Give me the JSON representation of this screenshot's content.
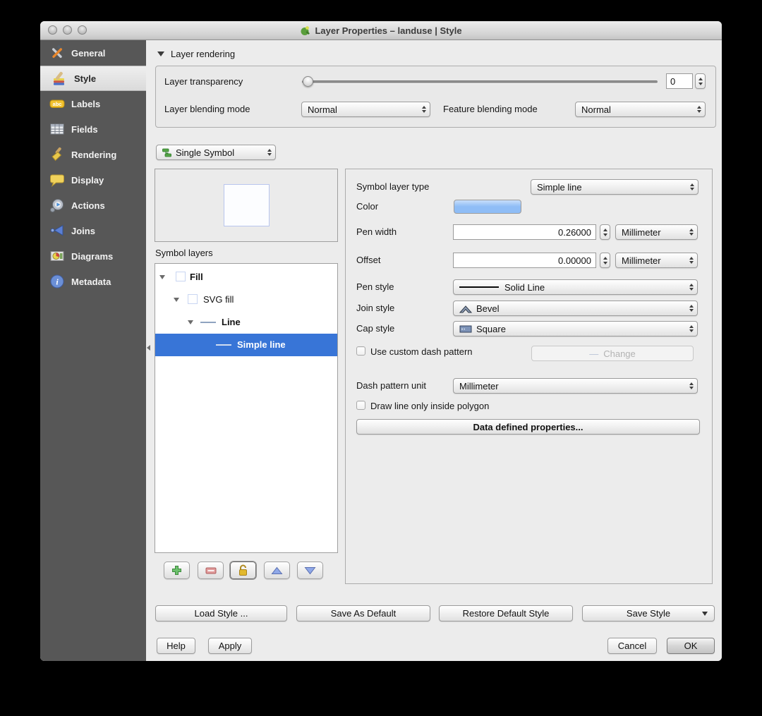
{
  "window": {
    "title": "Layer Properties – landuse | Style"
  },
  "sidebar": {
    "items": [
      {
        "label": "General"
      },
      {
        "label": "Style"
      },
      {
        "label": "Labels"
      },
      {
        "label": "Fields"
      },
      {
        "label": "Rendering"
      },
      {
        "label": "Display"
      },
      {
        "label": "Actions"
      },
      {
        "label": "Joins"
      },
      {
        "label": "Diagrams"
      },
      {
        "label": "Metadata"
      }
    ],
    "selected": "Style"
  },
  "layer_rendering": {
    "header": "Layer rendering",
    "transparency_label": "Layer transparency",
    "transparency_value": "0",
    "layer_blending_label": "Layer blending mode",
    "layer_blending_value": "Normal",
    "feature_blending_label": "Feature blending mode",
    "feature_blending_value": "Normal"
  },
  "renderer": {
    "selected": "Single Symbol"
  },
  "symbol": {
    "layers_label": "Symbol layers",
    "tree": [
      {
        "label": "Fill"
      },
      {
        "label": "SVG fill"
      },
      {
        "label": "Line"
      },
      {
        "label": "Simple line"
      }
    ]
  },
  "properties": {
    "symbol_layer_type_label": "Symbol layer type",
    "symbol_layer_type_value": "Simple line",
    "color_label": "Color",
    "pen_width_label": "Pen width",
    "pen_width_value": "0.26000",
    "pen_width_unit": "Millimeter",
    "offset_label": "Offset",
    "offset_value": "0.00000",
    "offset_unit": "Millimeter",
    "pen_style_label": "Pen style",
    "pen_style_value": "Solid Line",
    "join_style_label": "Join style",
    "join_style_value": "Bevel",
    "cap_style_label": "Cap style",
    "cap_style_value": "Square",
    "custom_dash_label": "Use custom dash pattern",
    "change_button": "Change",
    "dash_unit_label": "Dash pattern unit",
    "dash_unit_value": "Millimeter",
    "draw_inside_label": "Draw line only inside polygon",
    "data_defined_button": "Data defined properties..."
  },
  "footer": {
    "load_style": "Load Style ...",
    "save_as_default": "Save As Default",
    "restore_default": "Restore Default Style",
    "save_style": "Save Style",
    "help": "Help",
    "apply": "Apply",
    "cancel": "Cancel",
    "ok": "OK"
  },
  "colors": {
    "selection_blue": "#3875d7",
    "line_color_swatch": "#8fbdf6",
    "sidebar_bg": "#575757"
  }
}
